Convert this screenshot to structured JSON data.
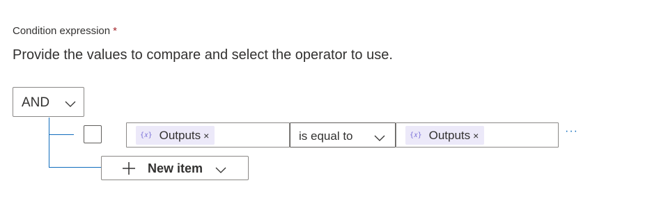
{
  "condition": {
    "label": "Condition expression",
    "required_marker": "*",
    "description": "Provide the values to compare and select the operator to use."
  },
  "group": {
    "operator_value": "AND"
  },
  "row": {
    "left_token": {
      "icon": "fx-expression-icon",
      "icon_text": "{𝑥}",
      "label": "Outputs",
      "remove": "×"
    },
    "operator_value": "is equal to",
    "right_token": {
      "icon": "fx-expression-icon",
      "icon_text": "{𝑥}",
      "label": "Outputs",
      "remove": "×"
    },
    "more_text": "···"
  },
  "new_item": {
    "label": "New item"
  },
  "colors": {
    "accent": "#0f6cbd",
    "token_bg": "#ece9f9",
    "required": "#a4262c"
  }
}
